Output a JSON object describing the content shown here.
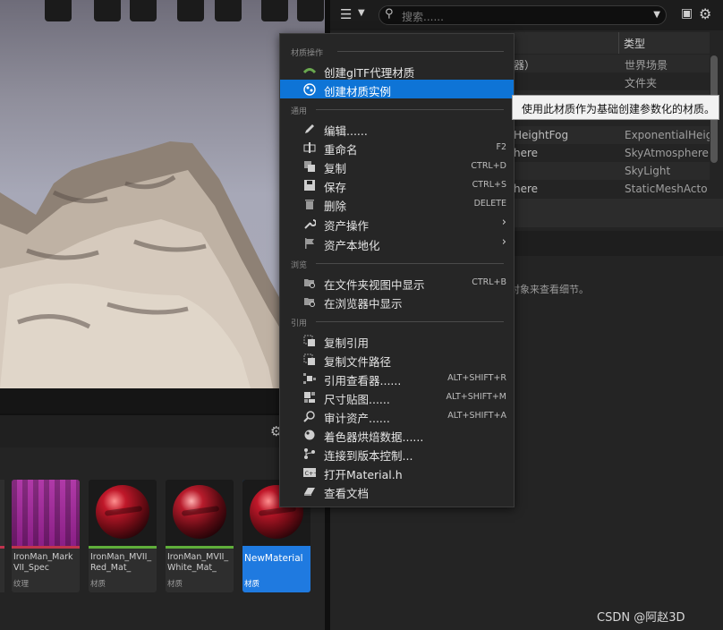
{
  "outliner": {
    "search_placeholder": "搜索......",
    "column_type": "类型",
    "rows": [
      {
        "name": "器）",
        "type": "世界场景"
      },
      {
        "name": "",
        "type": "文件夹"
      },
      {
        "name": "",
        "type": ""
      },
      {
        "name": "",
        "type": ""
      },
      {
        "name": "HeightFog",
        "type": "ExponentialHeig"
      },
      {
        "name": "here",
        "type": "SkyAtmosphere"
      },
      {
        "name": "",
        "type": "SkyLight"
      },
      {
        "name": "here",
        "type": "StaticMeshActo"
      }
    ],
    "details_hint": "对象来查看细节。"
  },
  "context_menu": {
    "section_material": "材质操作",
    "section_common": "通用",
    "section_browse": "浏览",
    "section_reference": "引用",
    "items": [
      {
        "label": "创建glTF代理材质",
        "shortcut": "",
        "icon": "gltf-icon"
      },
      {
        "label": "创建材质实例",
        "shortcut": "",
        "icon": "material-instance-icon"
      },
      {
        "label": "编辑......",
        "shortcut": "",
        "icon": "pencil-icon"
      },
      {
        "label": "重命名",
        "shortcut": "F2",
        "icon": "rename-icon"
      },
      {
        "label": "复制",
        "shortcut": "CTRL+D",
        "icon": "duplicate-icon"
      },
      {
        "label": "保存",
        "shortcut": "CTRL+S",
        "icon": "save-icon"
      },
      {
        "label": "删除",
        "shortcut": "DELETE",
        "icon": "trash-icon"
      },
      {
        "label": "资产操作",
        "shortcut": "",
        "icon": "wrench-icon"
      },
      {
        "label": "资产本地化",
        "shortcut": "",
        "icon": "flag-icon"
      },
      {
        "label": "在文件夹视图中显示",
        "shortcut": "CTRL+B",
        "icon": "folder-search-icon"
      },
      {
        "label": "在浏览器中显示",
        "shortcut": "",
        "icon": "folder-search-icon"
      },
      {
        "label": "复制引用",
        "shortcut": "",
        "icon": "copy-reference-icon"
      },
      {
        "label": "复制文件路径",
        "shortcut": "",
        "icon": "copy-path-icon"
      },
      {
        "label": "引用查看器......",
        "shortcut": "ALT+SHIFT+R",
        "icon": "reference-viewer-icon"
      },
      {
        "label": "尺寸贴图......",
        "shortcut": "ALT+SHIFT+M",
        "icon": "size-map-icon"
      },
      {
        "label": "审计资产......",
        "shortcut": "ALT+SHIFT+A",
        "icon": "audit-icon"
      },
      {
        "label": "着色器烘焙数据......",
        "shortcut": "",
        "icon": "shader-icon"
      },
      {
        "label": "连接到版本控制...",
        "shortcut": "",
        "icon": "source-control-icon"
      },
      {
        "label": "打开Material.h",
        "shortcut": "",
        "icon": "cpp-file-icon"
      },
      {
        "label": "查看文档",
        "shortcut": "",
        "icon": "book-icon"
      }
    ]
  },
  "tooltip": "使用此材质作为基础创建参数化的材质。",
  "assets": [
    {
      "name": "IronMan_MarkVII_Spec",
      "kind": "纹理"
    },
    {
      "name": "IronMan_MVII_Red_Mat_",
      "kind": "材质"
    },
    {
      "name": "IronMan_MVII_White_Mat_",
      "kind": "材质"
    },
    {
      "name": "NewMaterial",
      "kind": "材质"
    }
  ],
  "watermark": "CSDN @阿赵3D",
  "colors": {
    "highlight": "#0e74d6",
    "texture_bar": "#c0334d",
    "material_bar": "#5fae3a"
  }
}
